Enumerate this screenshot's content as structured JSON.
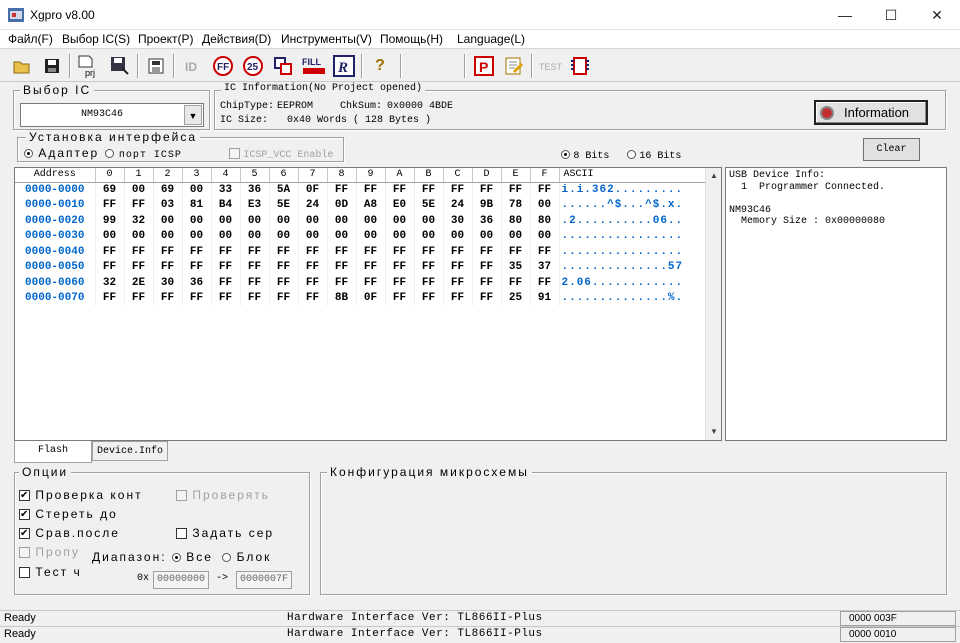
{
  "window": {
    "title": "Xgpro v8.00",
    "minimize": "—",
    "maximize": "☐",
    "close": "✕"
  },
  "menu": [
    "Файл(F)",
    "Выбор IC(S)",
    "Проект(P)",
    "Действия(D)",
    "Инструменты(V)",
    "Помощь(H)",
    "Language(L)"
  ],
  "toolbar": {
    "icons": [
      "open-icon",
      "save-icon",
      "project-icon",
      "save-project-icon",
      "save-chip-icon",
      "read-id-icon",
      "erase-icon",
      "blank-check-icon",
      "verify-icon",
      "fill-icon",
      "read-icon",
      "help-icon",
      "program-icon",
      "edit-icon",
      "test-icon",
      "chip-icon"
    ],
    "fill_label": "FILL",
    "prj_label": "prj",
    "test_label": "TEST",
    "help_label": "?"
  },
  "select_ic": {
    "legend": "Выбор IC",
    "chip": "NM93C46"
  },
  "ic_info": {
    "legend": "IC Information(No Project opened)",
    "chip_type_label": "ChipType:",
    "chip_type": "EEPROM",
    "chksum_label": "ChkSum:",
    "chksum": "0x0000 4BDE",
    "ic_size_label": "IC Size:",
    "ic_size": "0x40 Words ( 128 Bytes )",
    "info_button": "Information"
  },
  "interface": {
    "legend": "Установка интерфейса",
    "adapter": "Адаптер",
    "port_icsp": "порт ICSP",
    "icsp_vcc": "ICSP_VCC Enable",
    "bits8": "8 Bits",
    "bits16": "16 Bits",
    "clear": "Clear"
  },
  "hex": {
    "headers": [
      "Address",
      "0",
      "1",
      "2",
      "3",
      "4",
      "5",
      "6",
      "7",
      "8",
      "9",
      "A",
      "B",
      "C",
      "D",
      "E",
      "F",
      "ASCII"
    ],
    "rows": [
      {
        "addr": "0000-0000",
        "bytes": [
          "69",
          "00",
          "69",
          "00",
          "33",
          "36",
          "5A",
          "0F",
          "FF",
          "FF",
          "FF",
          "FF",
          "FF",
          "FF",
          "FF",
          "FF"
        ],
        "ascii": "i.i.362........."
      },
      {
        "addr": "0000-0010",
        "bytes": [
          "FF",
          "FF",
          "03",
          "81",
          "B4",
          "E3",
          "5E",
          "24",
          "0D",
          "A8",
          "E0",
          "5E",
          "24",
          "9B",
          "78",
          "00"
        ],
        "ascii": "......^$...^$.x."
      },
      {
        "addr": "0000-0020",
        "bytes": [
          "99",
          "32",
          "00",
          "00",
          "00",
          "00",
          "00",
          "00",
          "00",
          "00",
          "00",
          "00",
          "30",
          "36",
          "80",
          "80"
        ],
        "ascii": ".2..........06.."
      },
      {
        "addr": "0000-0030",
        "bytes": [
          "00",
          "00",
          "00",
          "00",
          "00",
          "00",
          "00",
          "00",
          "00",
          "00",
          "00",
          "00",
          "00",
          "00",
          "00",
          "00"
        ],
        "ascii": "................"
      },
      {
        "addr": "0000-0040",
        "bytes": [
          "FF",
          "FF",
          "FF",
          "FF",
          "FF",
          "FF",
          "FF",
          "FF",
          "FF",
          "FF",
          "FF",
          "FF",
          "FF",
          "FF",
          "FF",
          "FF"
        ],
        "ascii": "................"
      },
      {
        "addr": "0000-0050",
        "bytes": [
          "FF",
          "FF",
          "FF",
          "FF",
          "FF",
          "FF",
          "FF",
          "FF",
          "FF",
          "FF",
          "FF",
          "FF",
          "FF",
          "FF",
          "35",
          "37"
        ],
        "ascii": "..............57"
      },
      {
        "addr": "0000-0060",
        "bytes": [
          "32",
          "2E",
          "30",
          "36",
          "FF",
          "FF",
          "FF",
          "FF",
          "FF",
          "FF",
          "FF",
          "FF",
          "FF",
          "FF",
          "FF",
          "FF"
        ],
        "ascii": "2.06............"
      },
      {
        "addr": "0000-0070",
        "bytes": [
          "FF",
          "FF",
          "FF",
          "FF",
          "FF",
          "FF",
          "FF",
          "FF",
          "8B",
          "0F",
          "FF",
          "FF",
          "FF",
          "FF",
          "25",
          "91"
        ],
        "ascii": "..............%."
      }
    ]
  },
  "usb_info": {
    "lines": [
      "USB Device Info:",
      "  1  Programmer Connected.",
      "",
      "NM93C46",
      "  Memory Size : 0x00000080"
    ]
  },
  "tabs": [
    "Flash",
    "Device.Info"
  ],
  "options": {
    "legend": "Опции",
    "check_contacts": "Проверка конт",
    "verify": "Проверять",
    "erase": "Стереть до",
    "compare": "Срав.после",
    "set_serial": "Задать сер",
    "skip": "Пропу",
    "test": "Тест ч",
    "range_label": "Диапазон:",
    "range_all": "Все",
    "range_block": "Блок",
    "ox": "0x",
    "start": "00000000",
    "arrow": "->",
    "end": "0000007F"
  },
  "config": {
    "legend": "Конфигурация микросхемы"
  },
  "status": {
    "ready": "Ready",
    "hw": "Hardware Interface Ver: TL866II-Plus",
    "addr1": "0000 003F",
    "addr2": "0000 0010"
  }
}
